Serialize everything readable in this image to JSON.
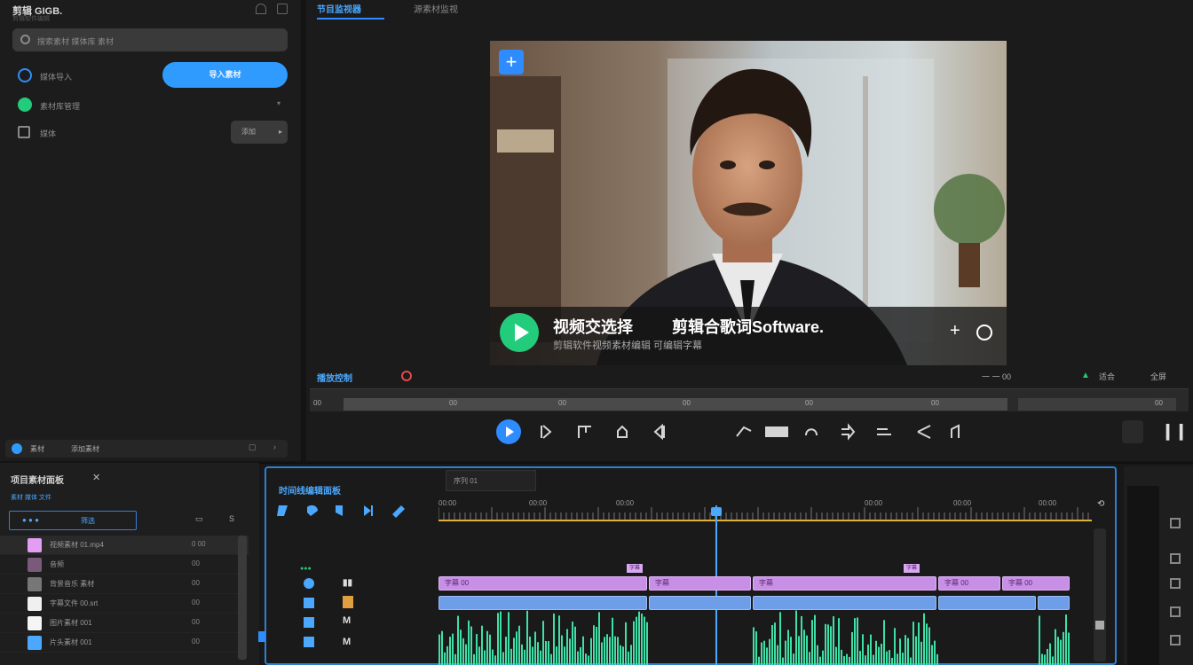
{
  "app": {
    "title": "剪辑 GIGB.",
    "subtitle": "剪辑软件编辑"
  },
  "left": {
    "search_placeholder": "搜索素材 媒体库 素材",
    "row1_label": "媒体导入",
    "row1_button": "导入素材",
    "row2_label": "素材库管理",
    "row3_label": "媒体",
    "row3_select": "添加",
    "bottom_label": "素材",
    "bottom_value": "添加素材"
  },
  "viewer": {
    "tab_active": "节目监视器",
    "tab_other": "源素材监视",
    "caption_left": "视频交选择",
    "caption_right": "剪辑合歌词Software.",
    "caption_sub": "剪辑软件视频素材编辑 可编辑字幕",
    "timecode": "播放控制",
    "right_labels": [
      "一 一 00",
      "适合",
      "全屏"
    ]
  },
  "ruler_ticks": [
    "00",
    "00",
    "00",
    "00",
    "00",
    "00",
    "00"
  ],
  "project": {
    "title": "项目素材面板",
    "subtitle": "素材 媒体 文件",
    "filter": "筛选",
    "items": [
      {
        "name": "视频素材 01.mp4",
        "num": "0 00",
        "color": "#e39df2"
      },
      {
        "name": "音频",
        "num": "00",
        "color": "#7a5a7a"
      },
      {
        "name": "背景音乐 素材",
        "num": "00",
        "color": "#777777"
      },
      {
        "name": "字幕文件 00.srt",
        "num": "00",
        "color": "#f0f0f0"
      },
      {
        "name": "图片素材 001",
        "num": "00",
        "color": "#f5f5f5"
      },
      {
        "name": "片头素材 001",
        "num": "00",
        "color": "#4aa8ff"
      }
    ]
  },
  "timeline": {
    "title": "时间线编辑面板",
    "tab_label": "序列 01",
    "ruler": [
      "00:00",
      "00:00",
      "00:00",
      "00:00",
      "00:00",
      "00:00",
      "00:00"
    ],
    "clip_labels": [
      "字幕",
      "字幕"
    ],
    "pink_clips": [
      "字幕 00",
      "字幕",
      "字幕",
      "字幕 00",
      "字幕 00"
    ]
  },
  "colors": {
    "accent": "#2f9bff",
    "green": "#22cc7a",
    "clip_pink": "#c88fe6",
    "clip_blue": "#6f9ee8",
    "wave": "#3fe0a8"
  }
}
